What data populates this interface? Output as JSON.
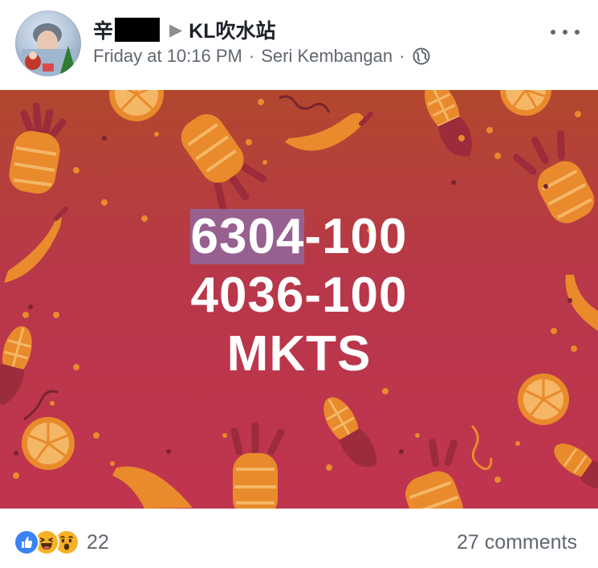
{
  "post": {
    "author": "辛",
    "group": "KL吹水站",
    "time": "Friday at 10:16 PM",
    "location": "Seri Kembangan",
    "separator": "·"
  },
  "image": {
    "line1_highlight": "6304",
    "line1_rest": "-100",
    "line2": "4036-100",
    "line3": "MKTS",
    "colors": {
      "top": "#b2472e",
      "bottom": "#c0344f",
      "fruit": "#e98a2c",
      "leaf": "#9c2b3b"
    }
  },
  "footer": {
    "reaction_count": "22",
    "comments": "27 comments"
  },
  "icons": {
    "more": "more-horizontal-icon",
    "audience": "globe-icon",
    "reactions": [
      "like-icon",
      "haha-icon",
      "wow-icon"
    ]
  }
}
